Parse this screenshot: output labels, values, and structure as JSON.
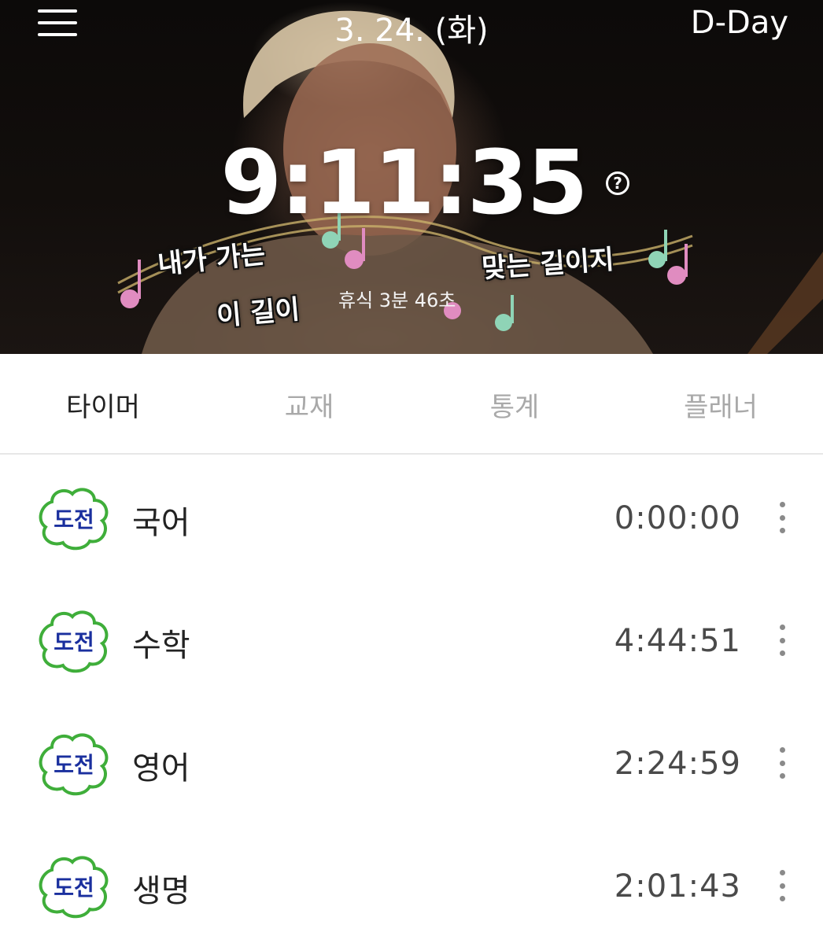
{
  "header": {
    "date": "3. 24. (화)",
    "dday_label": "D-Day",
    "clock": "9:11:35",
    "help_glyph": "?",
    "rest_label": "휴식 3분 46초",
    "photo_captions": [
      "내가 가는",
      "이 길이",
      "맞는 길이지"
    ]
  },
  "tabs": [
    {
      "label": "타이머",
      "active": true
    },
    {
      "label": "교재",
      "active": false
    },
    {
      "label": "통계",
      "active": false
    },
    {
      "label": "플래너",
      "active": false
    }
  ],
  "subjects": [
    {
      "badge": "도전",
      "name": "국어",
      "time": "0:00:00"
    },
    {
      "badge": "도전",
      "name": "수학",
      "time": "4:44:51"
    },
    {
      "badge": "도전",
      "name": "영어",
      "time": "2:24:59"
    },
    {
      "badge": "도전",
      "name": "생명",
      "time": "2:01:43"
    }
  ],
  "colors": {
    "badge_border": "#3fae3a",
    "badge_text": "#1a2f9e",
    "active_tab": "#222222",
    "inactive_tab": "#a9a9a9"
  },
  "icons": {
    "menu": "hamburger-icon",
    "help": "question-circle-icon",
    "more": "more-vertical-icon",
    "badge": "challenge-cloud-badge-icon"
  }
}
